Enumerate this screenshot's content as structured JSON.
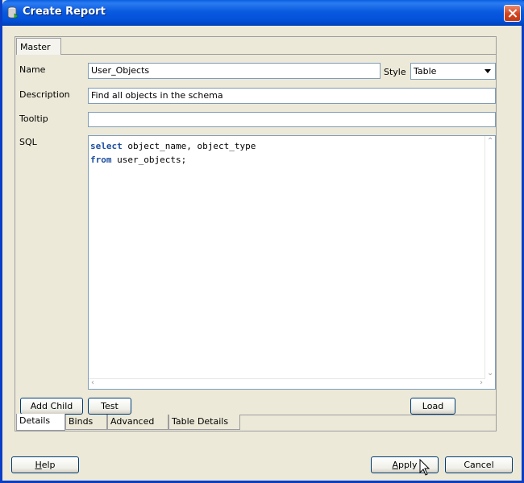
{
  "window": {
    "title": "Create Report"
  },
  "tabs": {
    "master": "Master"
  },
  "form": {
    "name_label": "Name",
    "name_value": "User_Objects",
    "style_label": "Style",
    "style_value": "Table",
    "description_label": "Description",
    "description_value": "Find all objects in the schema",
    "tooltip_label": "Tooltip",
    "tooltip_value": "",
    "sql_label": "SQL",
    "sql_lines": [
      {
        "keyword": "select",
        "rest": " object_name, object_type"
      },
      {
        "keyword": "from",
        "rest": " user_objects;"
      }
    ]
  },
  "actions": {
    "add_child": "Add Child",
    "test": "Test",
    "load": "Load"
  },
  "bottom_tabs": [
    "Details",
    "Binds",
    "Advanced",
    "Table Details"
  ],
  "footer": {
    "help": "Help",
    "apply": "Apply",
    "cancel": "Cancel"
  },
  "icons": {
    "app": "database-icon",
    "close": "close-icon",
    "dropdown": "chevron-down-icon",
    "cursor": "mouse-pointer-icon"
  },
  "colors": {
    "titlebar": "#0a5ae0",
    "sql_keyword": "#1f4f9f",
    "dialog_bg": "#ece9d8"
  }
}
